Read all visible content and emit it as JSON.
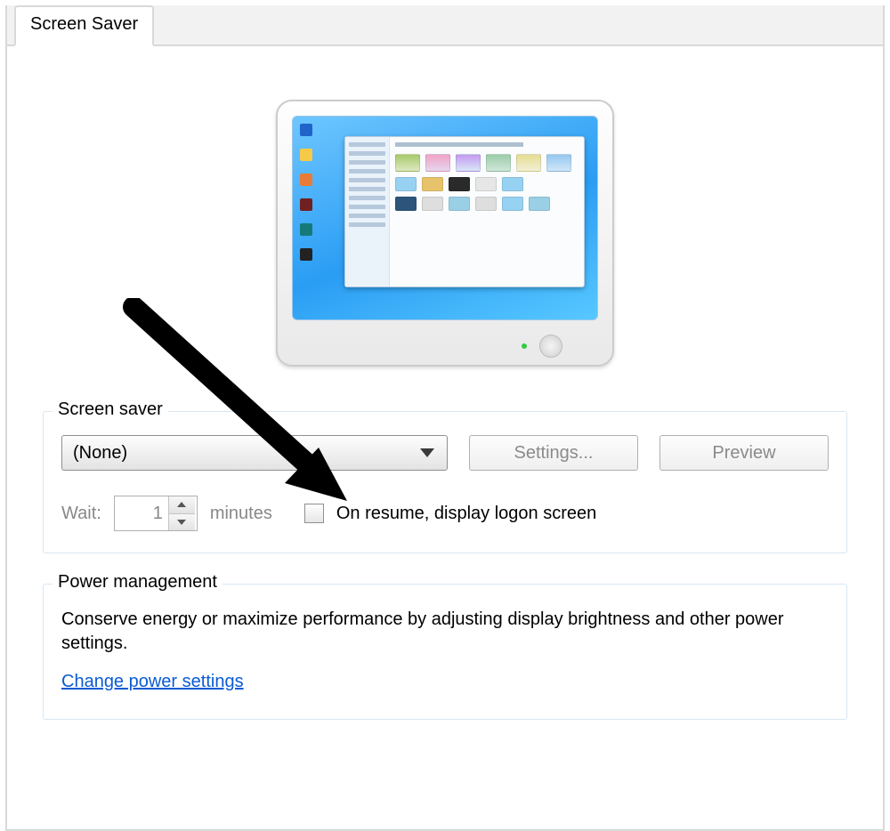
{
  "tab": {
    "label": "Screen Saver"
  },
  "screensaver": {
    "legend": "Screen saver",
    "dropdown_value": "(None)",
    "settings_label": "Settings...",
    "preview_label": "Preview",
    "wait_label": "Wait:",
    "wait_value": "1",
    "wait_unit": "minutes",
    "resume_label": "On resume, display logon screen"
  },
  "power": {
    "legend": "Power management",
    "description": "Conserve energy or maximize performance by adjusting display brightness and other power settings.",
    "link_label": "Change power settings"
  }
}
